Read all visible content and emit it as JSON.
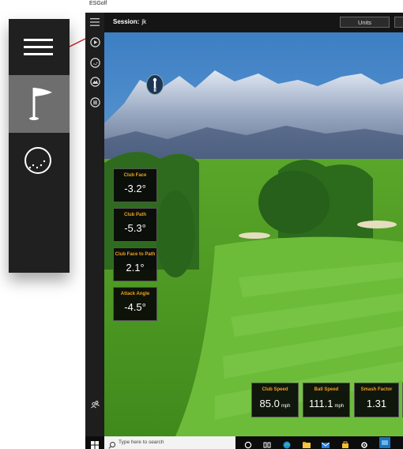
{
  "window": {
    "title": "ESGolf"
  },
  "header": {
    "session_label": "Session:",
    "session_value": "jk",
    "units_button": "Units"
  },
  "sidebar": {
    "items": [
      {
        "icon": "hamburger-menu-icon"
      },
      {
        "icon": "play-icon"
      },
      {
        "icon": "golf-ball-icon"
      },
      {
        "icon": "course-icon"
      },
      {
        "icon": "list-icon"
      },
      {
        "icon": "users-icon"
      }
    ]
  },
  "metrics_left": [
    {
      "label": "Club Face",
      "value": "-3.2°"
    },
    {
      "label": "Club Path",
      "value": "-5.3°"
    },
    {
      "label": "Club Face to Path",
      "value": "2.1°"
    },
    {
      "label": "Attack Angle",
      "value": "-4.5°"
    }
  ],
  "metrics_bottom": [
    {
      "label": "Club Speed",
      "value": "85.0",
      "unit": "mph"
    },
    {
      "label": "Ball Speed",
      "value": "111.1",
      "unit": "mph"
    },
    {
      "label": "Smash Factor",
      "value": "1.31",
      "unit": ""
    }
  ],
  "taskbar": {
    "search_placeholder": "Type here to search",
    "icons": [
      "start-icon",
      "cortana-icon",
      "task-view-icon",
      "edge-icon",
      "file-explorer-icon",
      "mail-icon",
      "store-icon",
      "settings-icon",
      "app-icon"
    ]
  },
  "inset": {
    "items": [
      "hamburger-menu-icon",
      "flag-icon",
      "golf-ball-icon"
    ],
    "selected_item": "flag-icon"
  },
  "colors": {
    "metric_label": "#f0a020",
    "sidebar_bg": "#1e1e1e",
    "selected_bg": "#6e6e6e",
    "callout_line": "#d0202a"
  }
}
